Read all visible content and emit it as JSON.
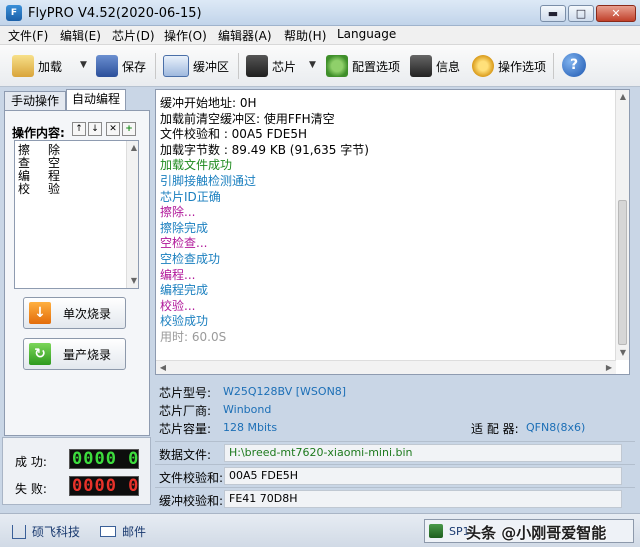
{
  "window": {
    "title": "FlyPRO V4.52(2020-06-15)",
    "app_icon_text": "F"
  },
  "window_buttons": {
    "minimize": "▬",
    "maximize": "□",
    "close": "✕"
  },
  "menu": [
    "文件(F)",
    "编辑(E)",
    "芯片(D)",
    "操作(O)",
    "编辑器(A)",
    "帮助(H)",
    "Language"
  ],
  "toolbar": {
    "load": "加载",
    "save": "保存",
    "buffer": "缓冲区",
    "chip": "芯片",
    "config": "配置选项",
    "info": "信息",
    "op_options": "操作选项",
    "help_glyph": "?"
  },
  "tabs": {
    "manual": "手动操作",
    "auto": "自动编程"
  },
  "ops": {
    "label": "操作内容:",
    "tools": [
      "↑",
      "↓",
      "✕",
      "+"
    ],
    "items": [
      "擦除",
      "查空",
      "编程",
      "校验"
    ]
  },
  "buttons": {
    "single_burn": "单次烧录",
    "mass_burn": "量产烧录"
  },
  "counters": {
    "success_label": "成 功:",
    "fail_label": "失 败:",
    "success_value": "0000 0",
    "fail_value": "0000 0"
  },
  "log": [
    {
      "text": "缓冲开始地址: 0H",
      "color": "#000000"
    },
    {
      "text": "加载前清空缓冲区: 使用FFH清空",
      "color": "#000000"
    },
    {
      "text": "文件校验和   : 00A5 FDE5H",
      "color": "#000000"
    },
    {
      "text": "加载字节数   : 89.49 KB (91,635 字节)",
      "color": "#000000"
    },
    {
      "text": "加载文件成功",
      "color": "#1e8a1e"
    },
    {
      "text": "引脚接触检测通过",
      "color": "#1a7fbf"
    },
    {
      "text": "芯片ID正确",
      "color": "#1a7fbf"
    },
    {
      "text": "擦除...",
      "color": "#b0189a"
    },
    {
      "text": "擦除完成",
      "color": "#1a7fbf"
    },
    {
      "text": "空检查...",
      "color": "#b0189a"
    },
    {
      "text": "空检查成功",
      "color": "#1a7fbf"
    },
    {
      "text": "编程...",
      "color": "#b0189a"
    },
    {
      "text": "编程完成",
      "color": "#1a7fbf"
    },
    {
      "text": "校验...",
      "color": "#b0189a"
    },
    {
      "text": "校验成功",
      "color": "#1a7fbf"
    },
    {
      "text": "用时: 60.0S",
      "color": "#9a9a9a"
    }
  ],
  "chip_info": {
    "model_label": "芯片型号:",
    "model_value": "W25Q128BV [WSON8]",
    "vendor_label": "芯片厂商:",
    "vendor_value": "Winbond",
    "capacity_label": "芯片容量:",
    "capacity_value": "128 Mbits",
    "adapter_label": "适 配 器:",
    "adapter_value": "QFN8(8x6)"
  },
  "files": {
    "data_file_label": "数据文件:",
    "data_file_value": "H:\\breed-mt7620-xiaomi-mini.bin",
    "file_checksum_label": "文件校验和:",
    "file_checksum_value": "00A5 FDE5H",
    "buffer_checksum_label": "缓冲校验和:",
    "buffer_checksum_value": "FE41 70D8H"
  },
  "status": {
    "company": "硕飞科技",
    "mail": "邮件",
    "device": "SP16",
    "watermark": "头条 @小刚哥爱智能"
  }
}
